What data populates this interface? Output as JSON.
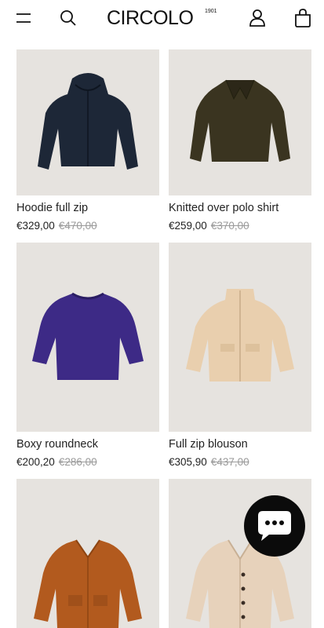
{
  "header": {
    "brand": "CIRCOLO",
    "brand_year": "1901"
  },
  "products": [
    {
      "name": "Hoodie full zip",
      "price": "€329,00",
      "old_price": "€470,00",
      "color": "#1d2737"
    },
    {
      "name": "Knitted over polo shirt",
      "price": "€259,00",
      "old_price": "€370,00",
      "color": "#3a3420"
    },
    {
      "name": "Boxy roundneck",
      "price": "€200,20",
      "old_price": "€286,00",
      "color": "#3d2a86"
    },
    {
      "name": "Full zip blouson",
      "price": "€305,90",
      "old_price": "€437,00",
      "color": "#e9cfae"
    },
    {
      "name": "",
      "price": "",
      "old_price": "",
      "color": "#b25a1e"
    },
    {
      "name": "",
      "price": "",
      "old_price": "",
      "color": "#e7d2bb"
    }
  ],
  "chat": {
    "icon": "chat-bubble-icon"
  }
}
